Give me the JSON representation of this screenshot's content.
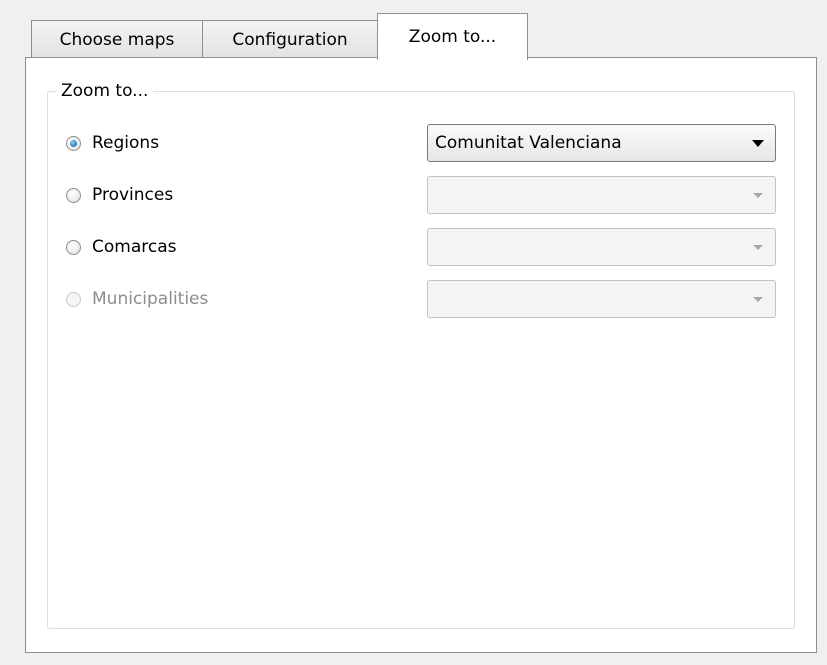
{
  "tabs": [
    {
      "label": "Choose maps",
      "active": false
    },
    {
      "label": "Configuration",
      "active": false
    },
    {
      "label": "Zoom to...",
      "active": true
    }
  ],
  "group": {
    "title": "Zoom to...",
    "options": [
      {
        "label": "Regions",
        "checked": true,
        "enabled": true,
        "combo_value": "Comunitat Valenciana",
        "combo_enabled": true
      },
      {
        "label": "Provinces",
        "checked": false,
        "enabled": true,
        "combo_value": "",
        "combo_enabled": false
      },
      {
        "label": "Comarcas",
        "checked": false,
        "enabled": true,
        "combo_value": "",
        "combo_enabled": false
      },
      {
        "label": "Municipalities",
        "checked": false,
        "enabled": false,
        "combo_value": "",
        "combo_enabled": false
      }
    ]
  },
  "icons": {
    "combo_arrow": "chevron-down-icon",
    "radio_selected": "radio-checked-icon",
    "radio_unselected": "radio-unchecked-icon"
  },
  "colors": {
    "window_bg": "#f0f0f0",
    "page_bg": "#ffffff",
    "radio_accent": "#2a82c7",
    "disabled_text": "#8d8d8d"
  }
}
